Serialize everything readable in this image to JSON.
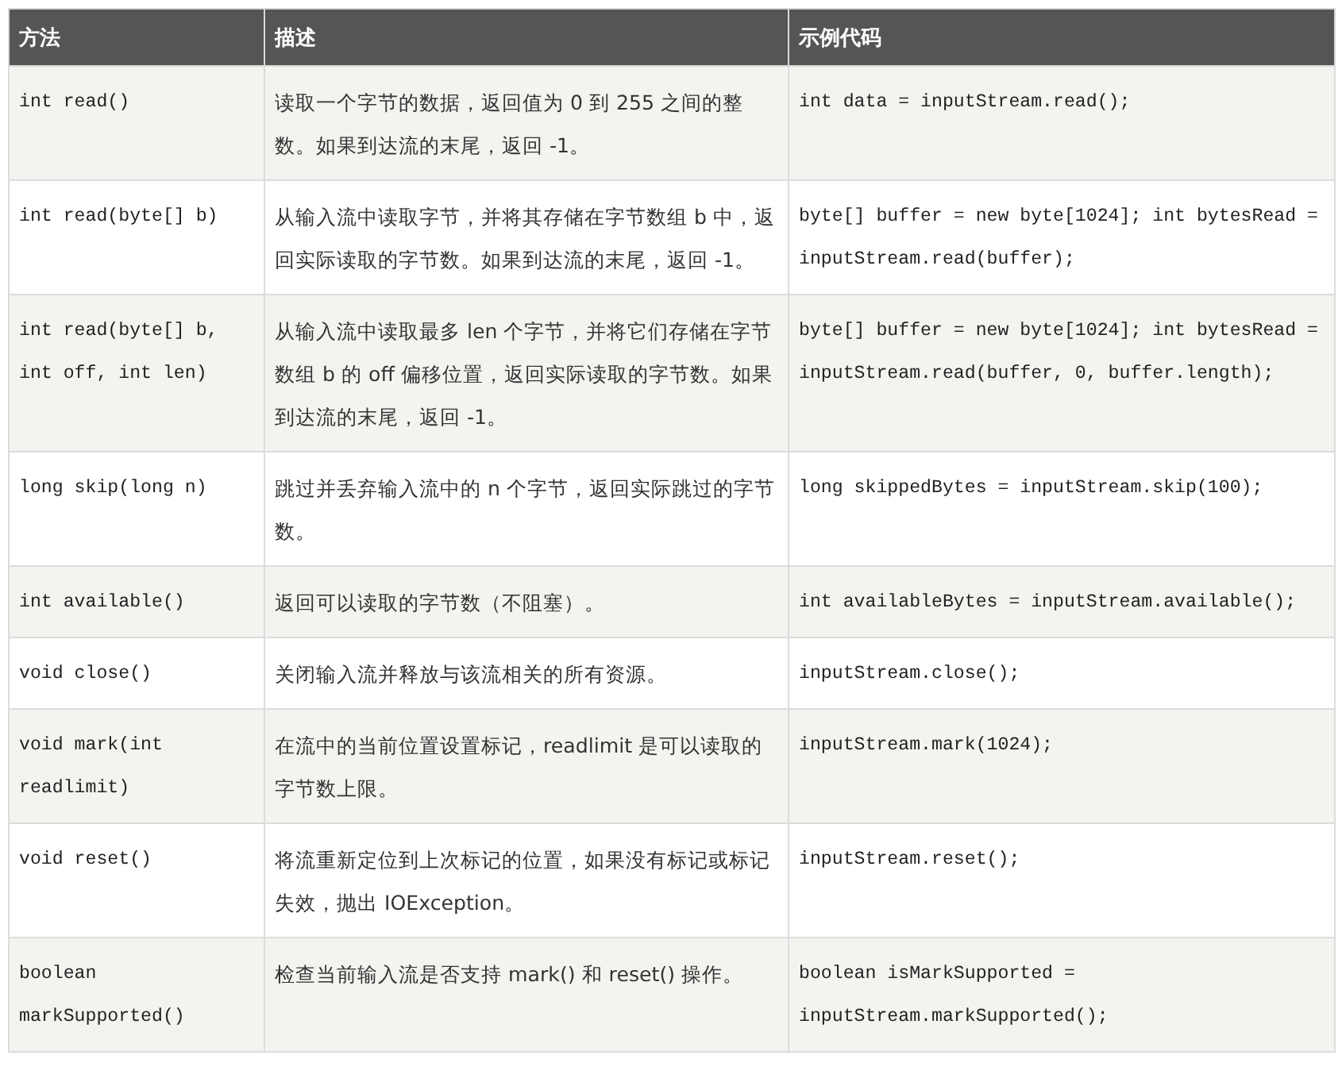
{
  "table": {
    "columns": [
      "方法",
      "描述",
      "示例代码"
    ],
    "rows": [
      {
        "method": "int read()",
        "description": "读取一个字节的数据，返回值为 0 到 255 之间的整数。如果到达流的末尾，返回 -1。",
        "example": "int data = inputStream.read();"
      },
      {
        "method": "int read(byte[] b)",
        "description": "从输入流中读取字节，并将其存储在字节数组 b 中，返回实际读取的字节数。如果到达流的末尾，返回 -1。",
        "example": "byte[] buffer = new byte[1024]; int bytesRead = inputStream.read(buffer);"
      },
      {
        "method": "int read(byte[] b, int off, int len)",
        "description": "从输入流中读取最多 len 个字节，并将它们存储在字节数组 b 的 off 偏移位置，返回实际读取的字节数。如果到达流的末尾，返回 -1。",
        "example": "byte[] buffer = new byte[1024]; int bytesRead = inputStream.read(buffer, 0, buffer.length);"
      },
      {
        "method": "long skip(long n)",
        "description": "跳过并丢弃输入流中的 n 个字节，返回实际跳过的字节数。",
        "example": "long skippedBytes = inputStream.skip(100);"
      },
      {
        "method": "int available()",
        "description": "返回可以读取的字节数（不阻塞）。",
        "example": "int availableBytes = inputStream.available();"
      },
      {
        "method": "void close()",
        "description": "关闭输入流并释放与该流相关的所有资源。",
        "example": "inputStream.close();"
      },
      {
        "method": "void mark(int readlimit)",
        "description": "在流中的当前位置设置标记，readlimit 是可以读取的字节数上限。",
        "example": "inputStream.mark(1024);"
      },
      {
        "method": "void reset()",
        "description": "将流重新定位到上次标记的位置，如果没有标记或标记失效，抛出 IOException。",
        "example": "inputStream.reset();"
      },
      {
        "method": "boolean markSupported()",
        "description": "检查当前输入流是否支持 mark() 和 reset() 操作。",
        "example": "boolean isMarkSupported = inputStream.markSupported();"
      }
    ]
  }
}
